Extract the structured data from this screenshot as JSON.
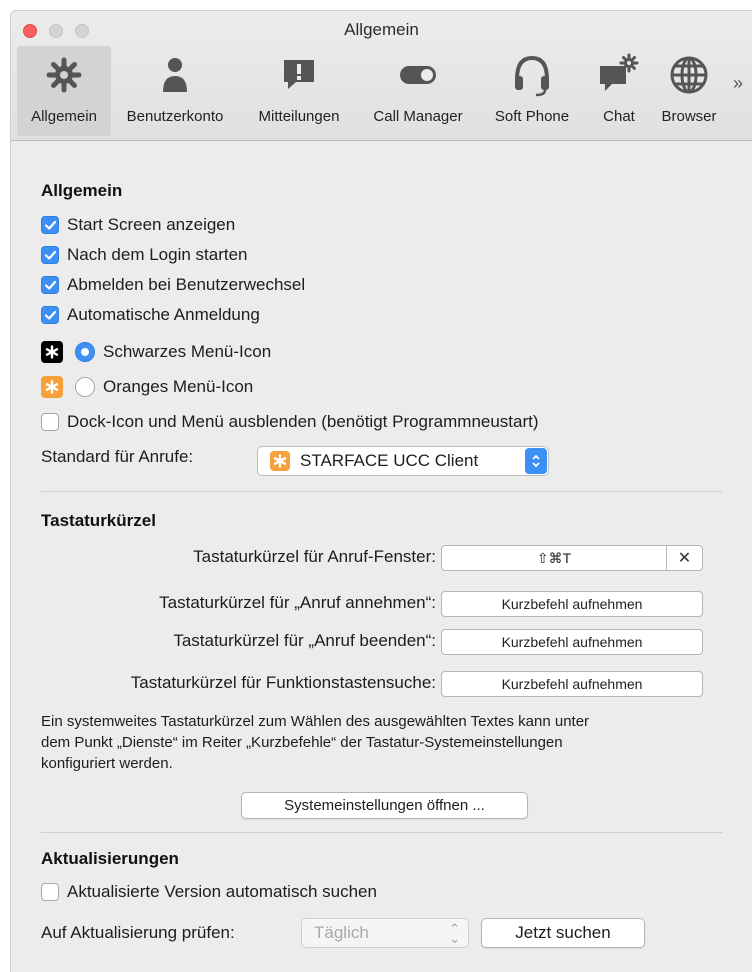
{
  "window": {
    "title": "Allgemein"
  },
  "toolbar": {
    "items": [
      {
        "label": "Allgemein",
        "icon": "gear-icon",
        "selected": true
      },
      {
        "label": "Benutzerkonto",
        "icon": "person-icon",
        "selected": false
      },
      {
        "label": "Mitteilungen",
        "icon": "notification-icon",
        "selected": false
      },
      {
        "label": "Call Manager",
        "icon": "toggle-icon",
        "selected": false
      },
      {
        "label": "Soft Phone",
        "icon": "headset-icon",
        "selected": false
      },
      {
        "label": "Chat",
        "icon": "chat-icon",
        "selected": false
      },
      {
        "label": "Browser",
        "icon": "globe-icon",
        "selected": false
      }
    ],
    "more": "»"
  },
  "general": {
    "title": "Allgemein",
    "checkboxes": [
      {
        "label": "Start Screen anzeigen",
        "checked": true
      },
      {
        "label": "Nach dem Login starten",
        "checked": true
      },
      {
        "label": "Abmelden bei Benutzerwechsel",
        "checked": true
      },
      {
        "label": "Automatische Anmeldung",
        "checked": true
      }
    ],
    "icon_options": [
      {
        "label": "Schwarzes Menü-Icon",
        "selected": true
      },
      {
        "label": "Oranges Menü-Icon",
        "selected": false
      }
    ],
    "hide_dock": {
      "label": "Dock-Icon und Menü ausblenden (benötigt Programmneustart)",
      "checked": false
    },
    "default_calls": {
      "label": "Standard für Anrufe:",
      "value": "STARFACE UCC Client"
    }
  },
  "shortcuts": {
    "title": "Tastaturkürzel",
    "rows": [
      {
        "label": "Tastaturkürzel für Anruf-Fenster:",
        "value": "⇧⌘T"
      },
      {
        "label": "Tastaturkürzel für „Anruf annehmen“:",
        "value": "Kurzbefehl aufnehmen"
      },
      {
        "label": "Tastaturkürzel für „Anruf beenden“:",
        "value": "Kurzbefehl aufnehmen"
      },
      {
        "label": "Tastaturkürzel für Funktionstastensuche:",
        "value": "Kurzbefehl aufnehmen"
      }
    ],
    "clear_label": "✕",
    "info_lines": [
      "Ein systemweites Tastaturkürzel zum Wählen des ausgewählten Textes kann unter",
      "dem Punkt „Dienste“ im Reiter „Kurzbefehle“ der Tastatur-Systemeinstellungen",
      "konfiguriert werden."
    ],
    "open_settings_button": "Systemeinstellungen öffnen ..."
  },
  "updates": {
    "title": "Aktualisierungen",
    "auto_check": {
      "label": "Aktualisierte Version automatisch suchen",
      "checked": false
    },
    "check_label": "Auf Aktualisierung prüfen:",
    "frequency": "Täglich",
    "search_now_button": "Jetzt suchen"
  },
  "colors": {
    "accent": "#3b8ff5",
    "starface_orange": "#f6a13b"
  }
}
